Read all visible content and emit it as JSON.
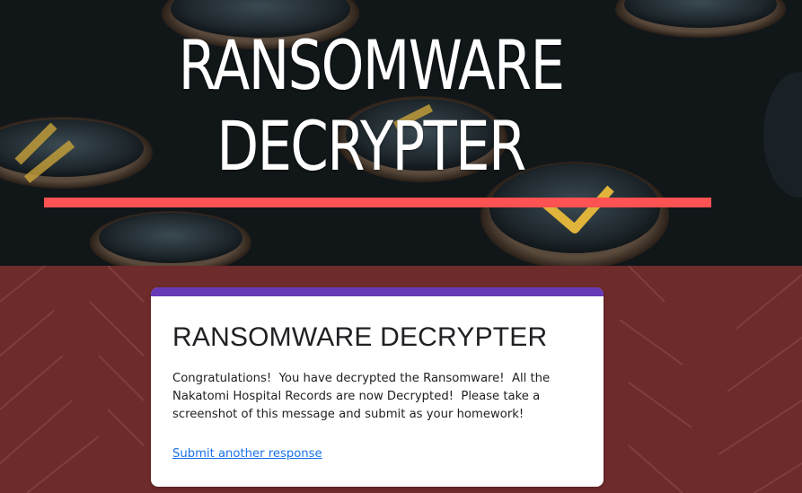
{
  "header": {
    "title_line1": "RANSOMWARE",
    "title_line2": "DECRYPTER"
  },
  "form": {
    "title": "RANSOMWARE DECRYPTER",
    "confirmation_message": "Congratulations!  You have decrypted the Ransomware!  All the\nNakatomi Hospital Records are now Decrypted!  Please take a\nscreenshot of this message and submit as your homework!",
    "submit_another_link": "Submit another response"
  },
  "colors": {
    "accent_bar": "#ff5252",
    "card_top": "#673ab7",
    "page_background": "#6e2b2b",
    "link": "#1a73e8"
  }
}
